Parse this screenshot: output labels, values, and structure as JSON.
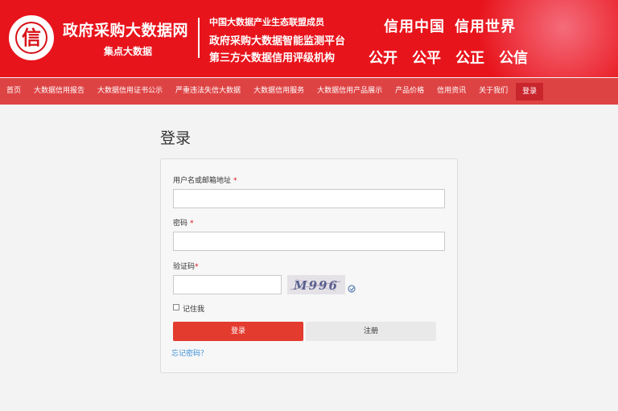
{
  "header": {
    "logo_char": "信",
    "site_name": "政府采购大数据网",
    "site_sub": "集点大数据",
    "tags": [
      "中国大数据产业生态联盟成员",
      "政府采购大数据智能监测平台",
      "第三方大数据信用评级机构"
    ],
    "slogan_top": [
      "信用中国",
      "信用世界"
    ],
    "slogan_bottom": [
      "公开",
      "公平",
      "公正",
      "公信"
    ]
  },
  "nav": {
    "items": [
      "首页",
      "大数据信用报告",
      "大数据信用证书公示",
      "严重违法失信大数据",
      "大数据信用服务",
      "大数据信用产品展示",
      "产品价格",
      "信用资讯",
      "关于我们"
    ],
    "login": "登录"
  },
  "page": {
    "title": "登录"
  },
  "form": {
    "username_label": "用户名或邮箱地址",
    "password_label": "密码",
    "captcha_label": "验证码",
    "required_mark": "*",
    "captcha_text": "M996",
    "remember_label": "记住我",
    "login_button": "登录",
    "register_button": "注册",
    "forgot_link": "忘记密码？"
  },
  "colors": {
    "brand_red": "#e8141c",
    "nav_red": "#de4344",
    "button_red": "#e33b2e",
    "link_blue": "#3a8fd8"
  }
}
